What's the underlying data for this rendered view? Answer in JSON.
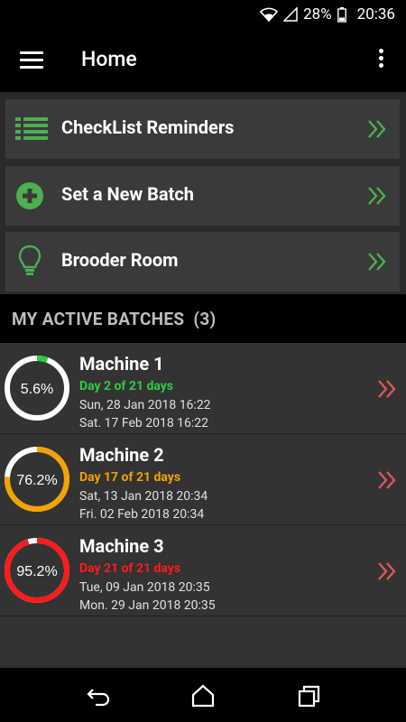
{
  "status_bar": {
    "battery": "28%",
    "time": "20:36"
  },
  "app_bar": {
    "title": "Home"
  },
  "menu": [
    {
      "label": "CheckList Reminders",
      "icon": "list-icon"
    },
    {
      "label": "Set a New Batch",
      "icon": "add-circle-icon"
    },
    {
      "label": "Brooder Room",
      "icon": "lightbulb-icon"
    }
  ],
  "section": {
    "title": "MY ACTIVE BATCHES  (3)"
  },
  "batches": [
    {
      "name": "Machine 1",
      "percent_text": "5.6%",
      "progress": 0.056,
      "day_text": "Day 2 of 21 days",
      "color": "#2ecc40",
      "start": "Sun, 28 Jan 2018 16:22",
      "end": "Sat. 17 Feb 2018 16:22"
    },
    {
      "name": "Machine 2",
      "percent_text": "76.2%",
      "progress": 0.762,
      "day_text": "Day 17 of 21 days",
      "color": "#f5a300",
      "start": "Sat, 13 Jan 2018 20:34",
      "end": "Fri. 02 Feb 2018 20:34"
    },
    {
      "name": "Machine 3",
      "percent_text": "95.2%",
      "progress": 0.952,
      "day_text": "Day 21 of 21 days",
      "color": "#ff1a1a",
      "start": "Tue, 09 Jan 2018 20:35",
      "end": "Mon. 29 Jan 2018 20:35"
    }
  ],
  "colors": {
    "accent_green": "#4caf50",
    "chevron_red": "#e05555"
  }
}
